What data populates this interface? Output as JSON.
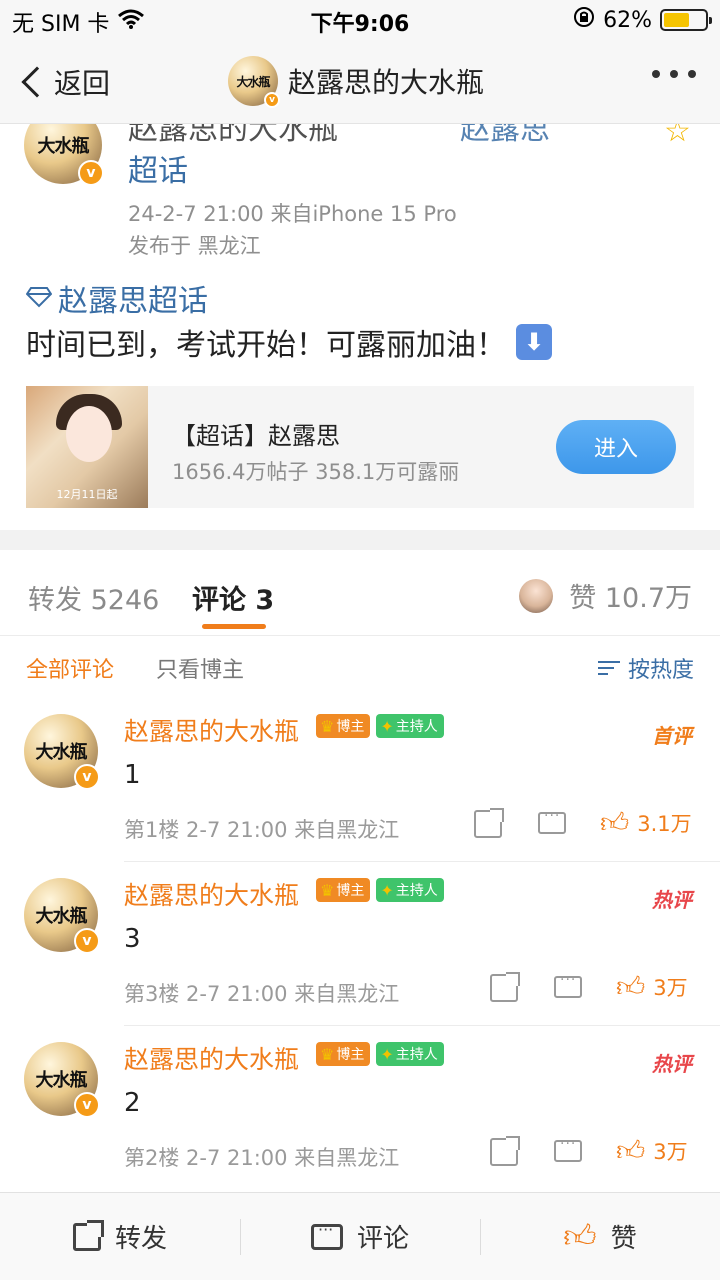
{
  "status_bar": {
    "carrier": "无 SIM 卡",
    "time": "下午9:06",
    "battery": "62%",
    "battery_level": 0.62
  },
  "nav": {
    "back_label": "返回",
    "title": "赵露思的大水瓶",
    "avatar_text": "大水瓶"
  },
  "post": {
    "author_cut": "赵露思的大水瓶",
    "link_cut": "赵露思",
    "chaohua_label": "超话",
    "time_source": "24-2-7 21:00  来自iPhone 15 Pro",
    "location": "发布于 黑龙江",
    "topic": "赵露思超话",
    "text": "时间已到，考试开始！可露丽加油！",
    "avatar_text": "大水瓶",
    "card": {
      "title": "【超话】赵露思",
      "subtitle": "1656.4万帖子 358.1万可露丽",
      "button": "进入",
      "thumb_caption": "12月11日起"
    }
  },
  "tabs": {
    "repost": "转发 5246",
    "comment": "评论 3",
    "like": "赞 10.7万"
  },
  "filter": {
    "all": "全部评论",
    "blogger_only": "只看博主",
    "sort": "按热度"
  },
  "badges": {
    "blogger": "博主",
    "host": "主持人"
  },
  "comments": [
    {
      "name": "赵露思的大水瓶",
      "tag": "首评",
      "text": "1",
      "meta": "第1楼 2-7 21:00  来自黑龙江",
      "likes": "3.1万",
      "avatar_text": "大水瓶"
    },
    {
      "name": "赵露思的大水瓶",
      "tag": "热评",
      "text": "3",
      "meta": "第3楼 2-7 21:00  来自黑龙江",
      "likes": "3万",
      "avatar_text": "大水瓶"
    },
    {
      "name": "赵露思的大水瓶",
      "tag": "热评",
      "text": "2",
      "meta": "第2楼 2-7 21:00  来自黑龙江",
      "likes": "3万",
      "avatar_text": "大水瓶"
    }
  ],
  "bottom_bar": {
    "repost": "转发",
    "comment": "评论",
    "like": "赞"
  },
  "colors": {
    "accent_orange": "#f07d1b",
    "link_blue": "#3a6ea5",
    "hot_red": "#e8474b",
    "button_blue": "#3d97ea"
  }
}
